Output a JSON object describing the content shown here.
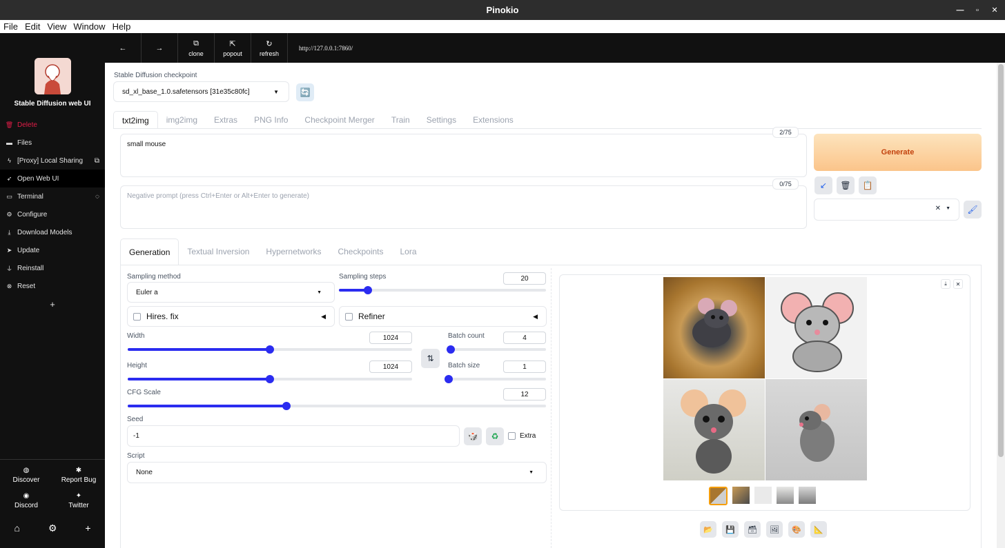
{
  "window": {
    "title": "Pinokio"
  },
  "menu": [
    "File",
    "Edit",
    "View",
    "Window",
    "Help"
  ],
  "sidebar": {
    "app_name": "Stable Diffusion web UI",
    "items": [
      {
        "label": "Delete",
        "icon": "trash-icon"
      },
      {
        "label": "Files",
        "icon": "folder-icon"
      },
      {
        "label": "[Proxy] Local Sharing",
        "icon": "bolt-icon"
      },
      {
        "label": "Open Web UI",
        "icon": "rocket-icon"
      },
      {
        "label": "Terminal",
        "icon": "monitor-icon"
      },
      {
        "label": "Configure",
        "icon": "gear-icon"
      },
      {
        "label": "Download Models",
        "icon": "download-icon"
      },
      {
        "label": "Update",
        "icon": "send-icon"
      },
      {
        "label": "Reinstall",
        "icon": "plug-icon"
      },
      {
        "label": "Reset",
        "icon": "x-circle-icon"
      }
    ],
    "add": "+",
    "bottom": [
      {
        "label": "Discover",
        "icon": "globe-icon"
      },
      {
        "label": "Report Bug",
        "icon": "bug-icon"
      },
      {
        "label": "Discord",
        "icon": "discord-icon"
      },
      {
        "label": "Twitter",
        "icon": "twitter-icon"
      }
    ]
  },
  "toolbar": {
    "back": "←",
    "forward": "→",
    "clone": "clone",
    "popout": "popout",
    "refresh": "refresh",
    "url": "http://127.0.0.1:7860/"
  },
  "checkpoint": {
    "label": "Stable Diffusion checkpoint",
    "value": "sd_xl_base_1.0.safetensors [31e35c80fc]"
  },
  "main_tabs": [
    "txt2img",
    "img2img",
    "Extras",
    "PNG Info",
    "Checkpoint Merger",
    "Train",
    "Settings",
    "Extensions"
  ],
  "prompt": {
    "value": "small mouse",
    "counter": "2/75"
  },
  "negative_prompt": {
    "placeholder": "Negative prompt (press Ctrl+Enter or Alt+Enter to generate)",
    "counter": "0/75"
  },
  "generate": {
    "label": "Generate"
  },
  "sub_tabs": [
    "Generation",
    "Textual Inversion",
    "Hypernetworks",
    "Checkpoints",
    "Lora"
  ],
  "params": {
    "sampling_method_label": "Sampling method",
    "sampling_method": "Euler a",
    "sampling_steps_label": "Sampling steps",
    "sampling_steps": "20",
    "hires_label": "Hires. fix",
    "refiner_label": "Refiner",
    "width_label": "Width",
    "width": "1024",
    "height_label": "Height",
    "height": "1024",
    "batch_count_label": "Batch count",
    "batch_count": "4",
    "batch_size_label": "Batch size",
    "batch_size": "1",
    "cfg_label": "CFG Scale",
    "cfg": "12",
    "seed_label": "Seed",
    "seed": "-1",
    "extra_label": "Extra",
    "script_label": "Script",
    "script": "None"
  },
  "sliders": {
    "sampling_steps": 0.14,
    "width": 0.5,
    "height": 0.5,
    "batch_count": 0.02,
    "batch_size": 0.0,
    "cfg": 0.38
  },
  "colors": {
    "accent": "#2b2cf0",
    "generate_bg": "#fdd59b",
    "generate_text": "#c2410c"
  }
}
